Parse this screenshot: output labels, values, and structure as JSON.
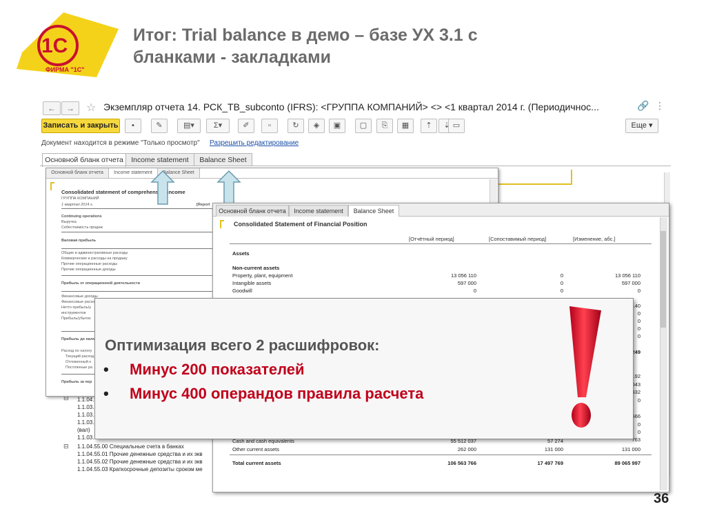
{
  "logo": {
    "brand": "1С",
    "caption": "ФИРМА \"1С\""
  },
  "slide_title_line1": "Итог: Trial balance  в демо – базе УХ  3.1 с",
  "slide_title_line2": "бланками - закладками",
  "window": {
    "title": "Экземпляр отчета 14. РСК_ТВ_subconto (IFRS): <ГРУППА КОМПАНИЙ> <> <1 квартал 2014 г. (Периодичнос...",
    "back_icon": "←",
    "forward_icon": "→",
    "star_icon": "☆",
    "link_icon": "🔗",
    "more_icon": "⋮"
  },
  "toolbar": {
    "save_close_label": "Записать и закрыть",
    "more_label": "Еще ▾"
  },
  "mode_text": "Документ находится в режиме \"Только просмотр\"",
  "edit_link": "Разрешить редактирование",
  "tabs": [
    "Основной бланк отчета",
    "Income statement",
    "Balance Sheet"
  ],
  "income_window": {
    "tabs": [
      "Основной бланк отчета",
      "Income statement",
      "Balance Sheet"
    ],
    "title": "Consolidated statement of comprehensive income",
    "company": "ГРУППА КОМПАНИЙ",
    "period": "1 квартал 2014 г.",
    "report_label": "[Report",
    "lines": [
      "Continuing operations",
      "Выручка",
      "Себестоимость продаж",
      "Валовая прибыль",
      "Общие и административные расходы",
      "Коммерческие и расходы на продажу",
      "Прочие операционные расходы",
      "Прочие операционные доходы",
      "Прибыль от операционной деятельности",
      "Финансовые доходы",
      "Финансовые расходы",
      "Нетто прибыль/у",
      "инструментов",
      "Прибыль/убыток",
      "Прибыль до нало",
      "Расход по налогу",
      "Текущий расход",
      "Отложенный н",
      "Постоянные ра",
      "Прибыль за пер"
    ]
  },
  "tree_rows": [
    "1.1.04.",
    "1.1.03.",
    "1.1.03.",
    "1.1.03.",
    "(вал)",
    "1.1.03.",
    "1.1.04.55.00 Специальные счета в банках",
    "1.1.04.55.01 Прочие денежные средства и их экв",
    "1.1.04.55.02 Прочие денежные средства и их экв",
    "1.1.04.55.03 Краткосрочные депозиты сроком ме"
  ],
  "balance_window": {
    "tabs": [
      "Основной бланк отчета",
      "Income statement",
      "Balance Sheet"
    ],
    "title": "Consolidated Statement of Financial Position",
    "headers": [
      "[Отчётный период]",
      "[Сопоставимый период]",
      "[Изменение, абс.]"
    ],
    "section": "Assets",
    "subsection": "Non-current assets",
    "rows": [
      {
        "label": "Property, plant, equipment",
        "v1": "13 056 110",
        "v2": "0",
        "v3": "13 056 110"
      },
      {
        "label": "Intangible assets",
        "v1": "597 000",
        "v2": "0",
        "v3": "597 000"
      },
      {
        "label": "Goodwill",
        "v1": "0",
        "v2": "0",
        "v3": "0"
      }
    ],
    "right_partial": [
      "140",
      "0",
      "0",
      "0",
      "0",
      "249",
      "192",
      "043",
      "432",
      "0",
      "566",
      "0",
      "0",
      "763"
    ],
    "bottom_rows": [
      {
        "label": "Cash and cash equivalents",
        "v1": "55 512 037",
        "v2": "57 274",
        "v3": "55 514 763"
      },
      {
        "label": "Other current assets",
        "v1": "262 000",
        "v2": "131 000",
        "v3": "131 000"
      }
    ],
    "total": {
      "label": "Total current assets",
      "v1": "106 563 766",
      "v2": "17 497 769",
      "v3": "89 065 997"
    }
  },
  "callout": {
    "heading": "Оптимизация всего 2 расшифровок:",
    "bullets": [
      "Минус 200  показателей",
      "Минус 400 операндов правила расчета"
    ],
    "bullet_symbol": "•"
  },
  "slide_number": "36",
  "colors": {
    "accent_red": "#c0001a",
    "logo_yellow": "#f5d21a",
    "button_yellow": "#f7d83c",
    "link_blue": "#1a4fa8"
  }
}
